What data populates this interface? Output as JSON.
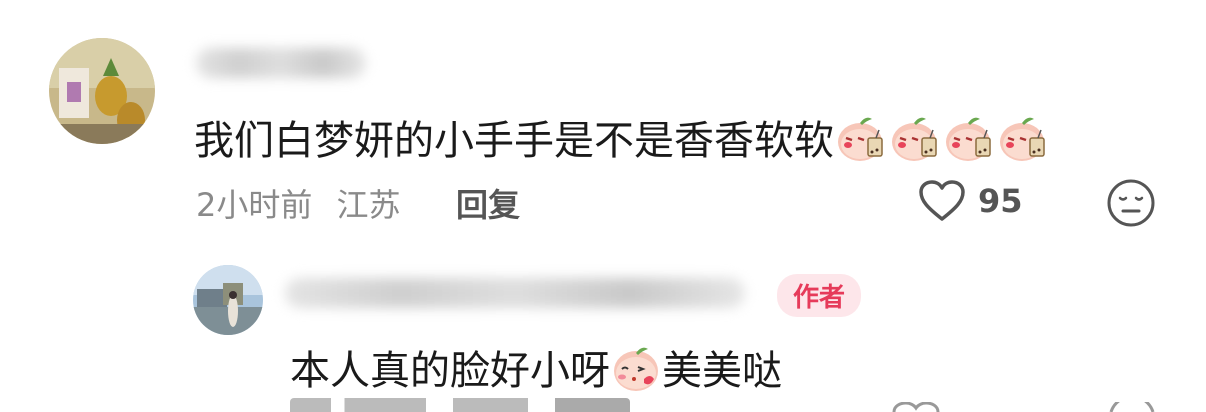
{
  "comment": {
    "text": "我们白梦妍的小手手是不是香香软软",
    "time": "2小时前",
    "location": "江苏",
    "reply_label": "回复",
    "likes": "95",
    "emoji_count": 4
  },
  "reply": {
    "badge": "作者",
    "text_before": "本人真的脸好小呀",
    "text_after": "美美哒"
  }
}
